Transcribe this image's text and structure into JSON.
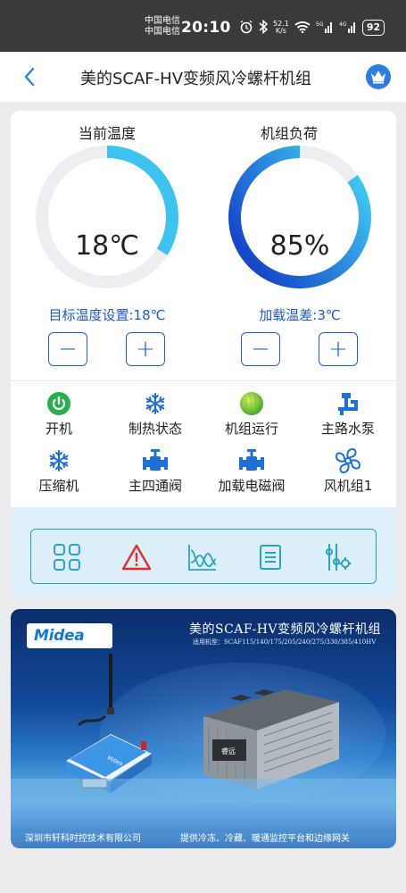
{
  "statusbar": {
    "carrier1": "中国电信",
    "carrier2": "中国电信",
    "time": "20:10",
    "speed_value": "52.1",
    "speed_unit": "K/s",
    "net1": "5G",
    "net2": "4G",
    "battery": "92"
  },
  "nav": {
    "title": "美的SCAF-HV变频风冷螺杆机组",
    "accent": "#2b7fe0"
  },
  "gauges": {
    "temperature": {
      "title": "当前温度",
      "value": "18℃",
      "fraction": 0.34,
      "color": "#3cc3ef"
    },
    "load": {
      "title": "机组负荷",
      "value": "85%",
      "fraction": 0.85,
      "color": "#1448c9"
    }
  },
  "controls": {
    "target_temp_label": "目标温度设置:18℃",
    "load_diff_label": "加载温差:3℃",
    "minus": "−",
    "plus": "+"
  },
  "status_items": [
    {
      "label": "开机",
      "icon": "power-icon"
    },
    {
      "label": "制热状态",
      "icon": "snowflake-icon"
    },
    {
      "label": "机组运行",
      "icon": "status-ball-icon"
    },
    {
      "label": "主路水泵",
      "icon": "pump-icon"
    },
    {
      "label": "压缩机",
      "icon": "snowflake-icon"
    },
    {
      "label": "主四通阀",
      "icon": "valve-icon"
    },
    {
      "label": "加载电磁阀",
      "icon": "valve-icon"
    },
    {
      "label": "风机组1",
      "icon": "fan-icon"
    }
  ],
  "toolbar": [
    {
      "icon": "grid-icon"
    },
    {
      "icon": "alarm-icon"
    },
    {
      "icon": "chart-icon"
    },
    {
      "icon": "list-icon"
    },
    {
      "icon": "settings-sliders-icon"
    }
  ],
  "banner": {
    "logo": "Midea",
    "title": "美的SCAF-HV变频风冷螺杆机组",
    "subtitle": "适用机型：SCAF115/140/175/205/240/275/330/385/410HV",
    "footer_left": "深圳市轩科时控技术有限公司",
    "footer_right": "提供冷冻、冷藏、暖通监控平台和边缘网关",
    "device_brand": "Midea",
    "unit_brand": "睿远"
  }
}
